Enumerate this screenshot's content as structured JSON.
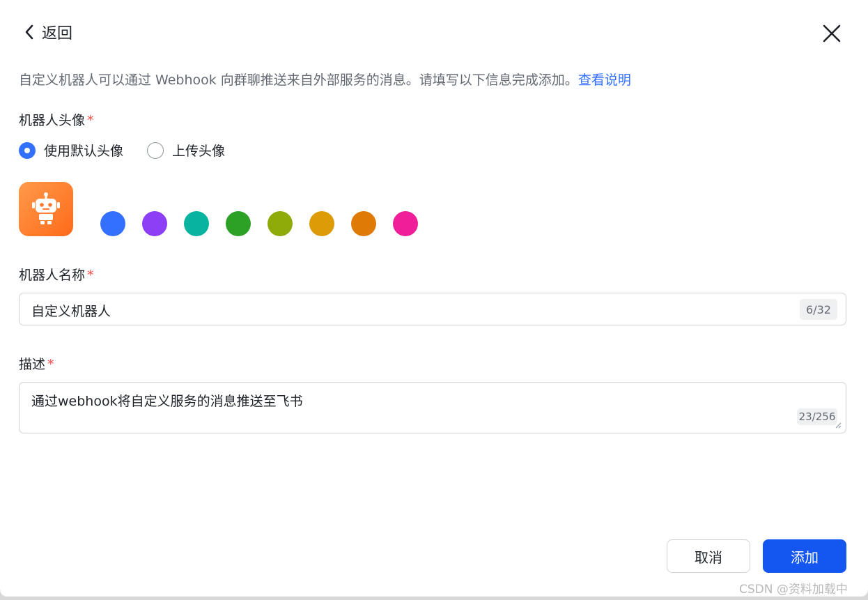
{
  "header": {
    "back_label": "返回"
  },
  "intro": {
    "text": "自定义机器人可以通过 Webhook 向群聊推送来自外部服务的消息。请填写以下信息完成添加。",
    "link": "查看说明"
  },
  "avatar_section": {
    "label": "机器人头像",
    "required_mark": "*",
    "options": [
      {
        "label": "使用默认头像",
        "selected": true
      },
      {
        "label": "上传头像",
        "selected": false
      }
    ],
    "avatar_icon": "robot-icon",
    "avatar_color": "#ff7a2e",
    "swatch_colors": [
      "#3370ff",
      "#8c3ff5",
      "#08b4a0",
      "#2da126",
      "#8fab09",
      "#dd9c05",
      "#df7a07",
      "#ee1f99"
    ]
  },
  "name_section": {
    "label": "机器人名称",
    "required_mark": "*",
    "value": "自定义机器人",
    "counter": "6/32"
  },
  "desc_section": {
    "label": "描述",
    "required_mark": "*",
    "value": "通过webhook将自定义服务的消息推送至飞书",
    "counter": "23/256"
  },
  "footer": {
    "cancel_label": "取消",
    "add_label": "添加"
  },
  "watermark": "CSDN @资料加载中",
  "colors": {
    "primary": "#1456f0",
    "link": "#3370ff",
    "required": "#f54a45"
  }
}
